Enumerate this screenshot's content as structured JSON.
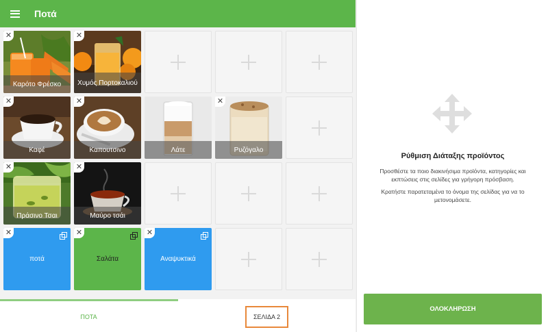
{
  "header": {
    "title": "Ποτά",
    "menu_icon": "hamburger-menu-icon"
  },
  "products": [
    {
      "label": "Καρότο Φρέσκο"
    },
    {
      "label": "Χυμός Πορτοκαλιού"
    },
    {
      "label": "Καφέ"
    },
    {
      "label": "Καπουτσινο"
    },
    {
      "label": "Λάτε"
    },
    {
      "label": "Ρυζόγαλο"
    },
    {
      "label": "Πράσινο Τσαι"
    },
    {
      "label": "Μαύρο τσάι"
    }
  ],
  "categories": [
    {
      "label": "ποτά",
      "color": "#2f9bef",
      "text_color": "#ffffff"
    },
    {
      "label": "Σαλάτα",
      "color": "#5cb54a",
      "text_color": "#222222"
    },
    {
      "label": "Αναψυκτικά",
      "color": "#2f9bef",
      "text_color": "#ffffff"
    }
  ],
  "remove_glyph": "✕",
  "tabs": [
    {
      "label": "ΠΟΤΑ",
      "active": true
    },
    {
      "label": "ΣΕΛΙΔΑ 2",
      "active": false
    }
  ],
  "panel": {
    "icon": "move-arrows-icon",
    "title": "Ρύθμιση Διάταξης προϊόντος",
    "text1": "Προσθέστε τα ποιο διακινήσιμα προϊόντα, κατηγορίες και εκπτώσεις στις σελίδες για γρήγορη πρόσβαση.",
    "text2": "Κρατήστε παρατεταμένα το όνομα της σελίδας για να το μετονομάσετε.",
    "done_label": "ΟΛΟΚΛΗΡΩΣΗ"
  },
  "colors": {
    "brand_green": "#5cb54a",
    "category_blue": "#2f9bef",
    "highlight_orange": "#e8883a"
  }
}
